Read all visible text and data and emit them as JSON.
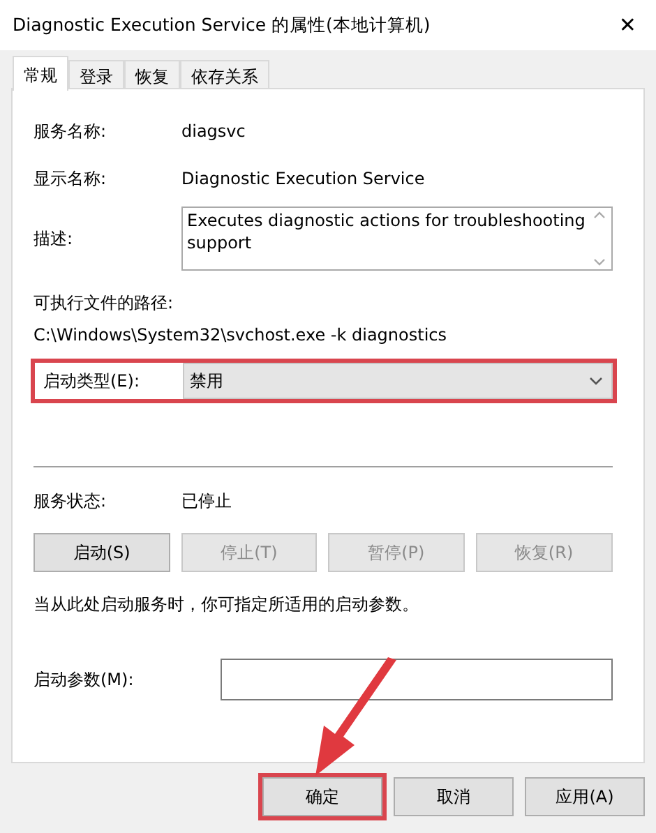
{
  "window": {
    "title": "Diagnostic Execution Service 的属性(本地计算机)",
    "close": "✕"
  },
  "tabs": [
    {
      "label": "常规",
      "selected": true
    },
    {
      "label": "登录",
      "selected": false
    },
    {
      "label": "恢复",
      "selected": false
    },
    {
      "label": "依存关系",
      "selected": false
    }
  ],
  "service_name": {
    "label": "服务名称:",
    "value": "diagsvc"
  },
  "display_name": {
    "label": "显示名称:",
    "value": "Diagnostic Execution Service"
  },
  "description": {
    "label": "描述:",
    "value": "Executes diagnostic actions for troubleshooting support"
  },
  "executable_path": {
    "label": "可执行文件的路径:",
    "value": "C:\\Windows\\System32\\svchost.exe -k diagnostics"
  },
  "startup_type": {
    "label": "启动类型(E):",
    "value": "禁用",
    "highlighted": true
  },
  "service_status": {
    "label": "服务状态:",
    "value": "已停止"
  },
  "control_buttons": [
    {
      "label": "启动(S)",
      "disabled": false
    },
    {
      "label": "停止(T)",
      "disabled": true
    },
    {
      "label": "暂停(P)",
      "disabled": true
    },
    {
      "label": "恢复(R)",
      "disabled": true
    }
  ],
  "hint": "当从此处启动服务时，你可指定所适用的启动参数。",
  "start_parameters": {
    "label": "启动参数(M):"
  },
  "dialog_buttons": [
    {
      "label": "确定",
      "highlighted": true
    },
    {
      "label": "取消",
      "highlighted": false
    },
    {
      "label": "应用(A)",
      "highlighted": false
    }
  ]
}
